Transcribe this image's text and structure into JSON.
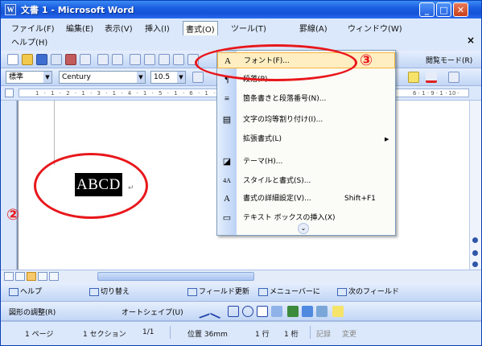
{
  "window": {
    "title": "文書 1 - Microsoft Word",
    "app_icon_glyph": "W",
    "buttons": {
      "minimize": "_",
      "maximize": "□",
      "close": "✕"
    }
  },
  "menubar": {
    "items": [
      "ファイル(F)",
      "編集(E)",
      "表示(V)",
      "挿入(I)",
      "書式(O)",
      "ツール(T)",
      "罫線(A)",
      "ウィンドウ(W)",
      "ヘルプ(H)"
    ],
    "close_doc": "×"
  },
  "toolbar_standard": {
    "right_label": "閲覧モード(R)"
  },
  "toolbar_formatting": {
    "style": "標準",
    "font": "Century",
    "size": "10.5"
  },
  "ruler": {
    "ticks": "1 · 1 · 2 · 1 · 3 · 1 · 4 · 1 · 5 · 1 · 6 · 1 · 7",
    "ticks_right": "6 · 1 · 9 · 1 · 10 ·"
  },
  "document": {
    "selected_text": "ABCD",
    "paragraph_mark": "↵"
  },
  "format_menu": {
    "items": [
      {
        "icon": "A",
        "label": "フォント(F)...",
        "highlighted": true
      },
      {
        "icon": "¶",
        "label": "段落(P)..."
      },
      {
        "icon": "≡",
        "label": "箇条書きと段落番号(N)..."
      },
      {
        "icon": "▤",
        "label": "文字の均等割り付け(I)..."
      },
      {
        "icon": "",
        "label": "拡張書式(L)",
        "submenu": true
      },
      {
        "icon": "◪",
        "label": "テーマ(H)..."
      },
      {
        "icon": "4A",
        "label": "スタイルと書式(S)..."
      },
      {
        "icon": "A",
        "label": "書式の詳細設定(V)...",
        "shortcut": "Shift+F1"
      },
      {
        "icon": "▭",
        "label": "テキスト ボックスの挿入(X)"
      }
    ],
    "expand": "⌄"
  },
  "field_toolbar": {
    "buttons": [
      "ヘルプ",
      "切り替え",
      "フィールド更新",
      "メニューバーに",
      "次のフィールド"
    ]
  },
  "drawing_toolbar": {
    "draw": "図形の調整(R)",
    "autoshapes": "オートシェイプ(U)"
  },
  "statusbar": {
    "page": "1 ページ",
    "section": "1 セクション",
    "pages": "1/1",
    "position": "位置 36mm",
    "line": "1 行",
    "column": "1 桁",
    "rec": "記録",
    "trk": "変更"
  },
  "annotations": {
    "step2": "②",
    "step3": "③"
  },
  "colors": {
    "annotation_red": "#e8171b",
    "menu_highlight": "#ffeec2",
    "title_blue": "#1553d6"
  }
}
